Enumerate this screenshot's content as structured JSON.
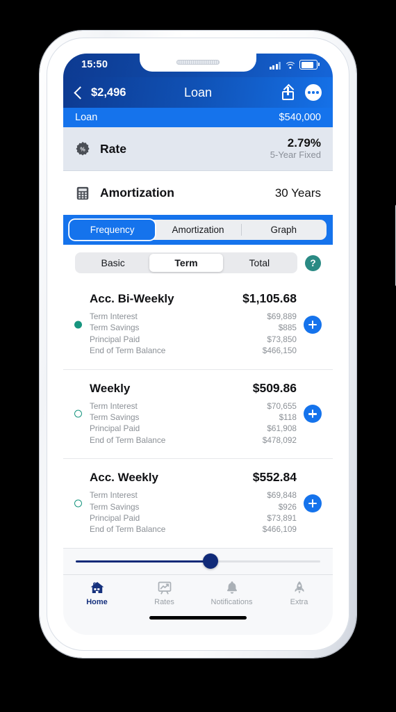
{
  "status_bar": {
    "time": "15:50",
    "signal_icon": "signal-bars-icon",
    "wifi_icon": "wifi-icon",
    "battery_icon": "battery-icon"
  },
  "nav": {
    "back_label": "$2,496",
    "title": "Loan",
    "share_icon": "share-icon",
    "more_icon": "more-options-icon"
  },
  "loan_strip": {
    "label": "Loan",
    "amount": "$540,000"
  },
  "rate_row": {
    "icon": "rate-badge-icon",
    "label": "Rate",
    "value": "2.79%",
    "sub": "5-Year Fixed"
  },
  "amortization_row": {
    "icon": "calculator-icon",
    "label": "Amortization",
    "value": "30 Years"
  },
  "primary_tabs": {
    "items": [
      {
        "label": "Frequency",
        "active": true
      },
      {
        "label": "Amortization",
        "active": false
      },
      {
        "label": "Graph",
        "active": false
      }
    ]
  },
  "secondary_tabs": {
    "items": [
      {
        "label": "Basic",
        "active": false
      },
      {
        "label": "Term",
        "active": true
      },
      {
        "label": "Total",
        "active": false
      }
    ],
    "help_label": "?"
  },
  "row_labels": {
    "term_interest": "Term Interest",
    "term_savings": "Term Savings",
    "principal_paid": "Principal Paid",
    "end_of_term_balance": "End of Term Balance"
  },
  "cards": [
    {
      "title": "Acc. Bi-Weekly",
      "amount": "$1,105.68",
      "selected": true,
      "term_interest": "$69,889",
      "term_savings": "$885",
      "principal_paid": "$73,850",
      "end_of_term_balance": "$466,150"
    },
    {
      "title": "Weekly",
      "amount": "$509.86",
      "selected": false,
      "term_interest": "$70,655",
      "term_savings": "$118",
      "principal_paid": "$61,908",
      "end_of_term_balance": "$478,092"
    },
    {
      "title": "Acc. Weekly",
      "amount": "$552.84",
      "selected": false,
      "term_interest": "$69,848",
      "term_savings": "$926",
      "principal_paid": "$73,891",
      "end_of_term_balance": "$466,109"
    }
  ],
  "slider": {
    "value_percent": 55
  },
  "tab_bar": {
    "items": [
      {
        "label": "Home",
        "icon": "home-icon",
        "active": true
      },
      {
        "label": "Rates",
        "icon": "chart-icon",
        "active": false
      },
      {
        "label": "Notifications",
        "icon": "bell-icon",
        "active": false
      },
      {
        "label": "Extra",
        "icon": "rocket-icon",
        "active": false
      }
    ]
  },
  "colors": {
    "brand_blue": "#1573ec",
    "navy": "#102a78",
    "teal": "#17957f",
    "help_teal": "#2a8a84"
  }
}
